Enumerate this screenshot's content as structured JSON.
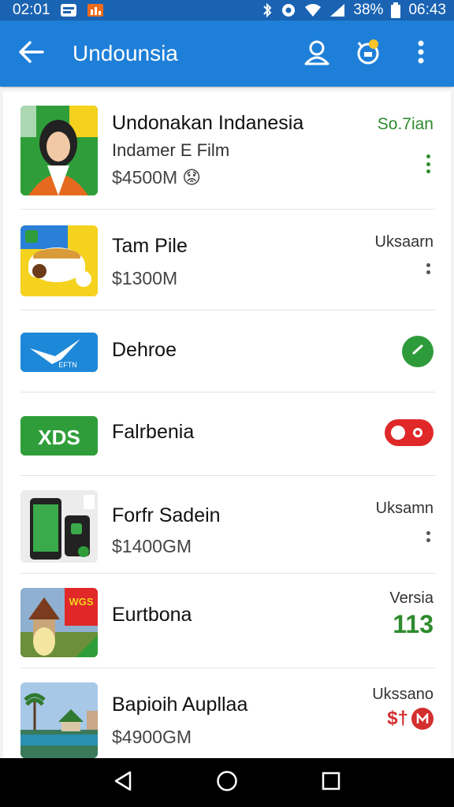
{
  "status_bar": {
    "time": "02:01",
    "battery": "38%",
    "clock_right": "06:43",
    "icons": [
      "notification-icon",
      "app-notification-icon",
      "bluetooth-icon",
      "location-icon",
      "wifi-icon",
      "signal-icon",
      "battery-icon"
    ]
  },
  "app_bar": {
    "title": "Undounsia",
    "icons": [
      "back-arrow-icon",
      "account-icon",
      "settings-sync-icon",
      "overflow-menu-icon"
    ]
  },
  "items": [
    {
      "name": "Undonakan Indanesia",
      "subtitle": "Indamer E Film",
      "price": "$4500M",
      "price_emoji": "😟",
      "right_label": "So.7ian",
      "right_color": "#2e8b2e",
      "thumb": "woman-portrait-thumbnail"
    },
    {
      "name": "Tam Pile",
      "price": "$1300M",
      "right_label": "Uksaarn",
      "thumb": "food-bowl-thumbnail"
    },
    {
      "name": "Dehroe",
      "right_status": "check",
      "thumb": "airline-thumbnail",
      "thumb_label": "EFTN"
    },
    {
      "name": "Falrbenia",
      "right_status": "toggle",
      "thumb": "xds-logo-thumbnail",
      "thumb_label": "XDS"
    },
    {
      "name": "Forfr Sadein",
      "price": "$1400GM",
      "right_label": "Uksamn",
      "thumb": "phones-thumbnail"
    },
    {
      "name": "Eurtbona",
      "right_label": "Versia",
      "right_value": "113",
      "right_color": "#2e8b2e",
      "thumb": "temple-thumbnail",
      "thumb_label": "WGS"
    },
    {
      "name": "Bapioih Aupllaa",
      "price": "$4900GM",
      "right_label": "Ukssano",
      "right_value": "$†",
      "right_color": "#d32f2f",
      "thumb": "resort-thumbnail"
    }
  ],
  "colors": {
    "status_bar": "#1a63b3",
    "app_bar": "#1e7fd8",
    "accent_green": "#2e8b2e",
    "accent_red": "#d32f2f"
  },
  "nav_bar": {
    "icons": [
      "nav-back-icon",
      "nav-home-icon",
      "nav-recents-icon"
    ]
  }
}
